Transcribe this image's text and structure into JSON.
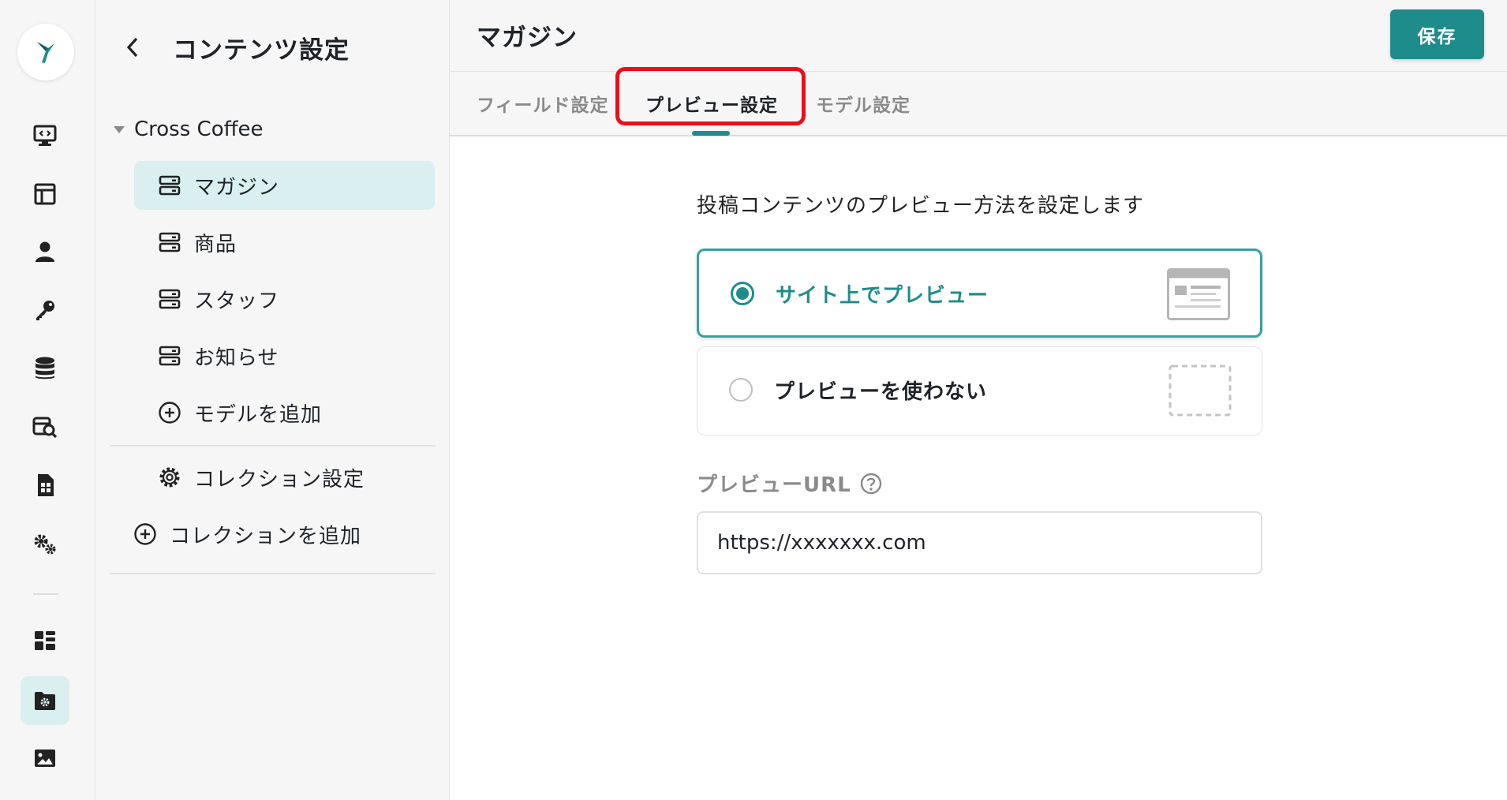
{
  "brand": {
    "accent": "#1f8c8c",
    "accent_light": "#d9eff0",
    "highlight": "#e8101a"
  },
  "rail": {
    "icons": [
      "logo-icon",
      "monitor-code-icon",
      "layout-icon",
      "user-icon",
      "key-icon",
      "database-icon",
      "search-db-icon",
      "document-icon",
      "gears-icon",
      "dashboard-icon",
      "folder-gear-icon",
      "image-icon"
    ],
    "active": "folder-gear-icon"
  },
  "nav": {
    "title": "コンテンツ設定",
    "collection": "Cross Coffee",
    "models": [
      {
        "label": "マガジン",
        "active": true
      },
      {
        "label": "商品",
        "active": false
      },
      {
        "label": "スタッフ",
        "active": false
      },
      {
        "label": "お知らせ",
        "active": false
      }
    ],
    "add_model": "モデルを追加",
    "collection_settings": "コレクション設定",
    "add_collection": "コレクションを追加"
  },
  "header": {
    "title": "マガジン",
    "save_label": "保存"
  },
  "tabs": [
    {
      "label": "フィールド設定",
      "active": false
    },
    {
      "label": "プレビュー設定",
      "active": true
    },
    {
      "label": "モデル設定",
      "active": false
    }
  ],
  "preview": {
    "description": "投稿コンテンツのプレビュー方法を設定します",
    "options": [
      {
        "label": "サイト上でプレビュー",
        "selected": true
      },
      {
        "label": "プレビューを使わない",
        "selected": false
      }
    ],
    "url_label": "プレビューURL",
    "url_value": "https://xxxxxxx.com"
  }
}
